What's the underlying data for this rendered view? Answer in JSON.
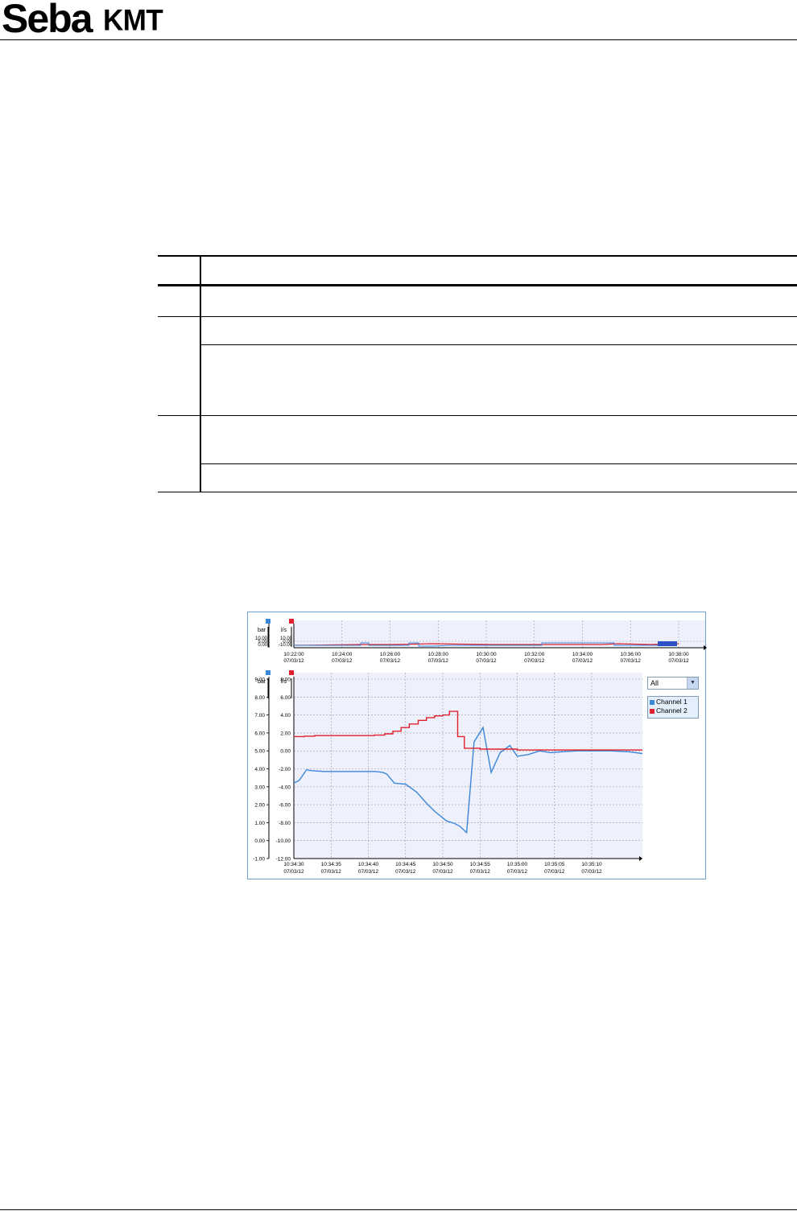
{
  "header": {
    "logo_text_1": "Seba",
    "logo_text_2": "KMT"
  },
  "screenshot": {
    "channel_select": {
      "value": "All"
    },
    "legend": [
      {
        "label": "Channel 1",
        "color": "#3b86d8"
      },
      {
        "label": "Channel 2",
        "color": "#e0202a"
      }
    ],
    "colors": {
      "plot_bg": "#eef0fb",
      "channel1": "#3b86d8",
      "channel2": "#e0202a"
    }
  },
  "chart_data": [
    {
      "type": "line",
      "role": "overview",
      "y_units": {
        "left": "bar",
        "right": "l/s"
      },
      "ticks_left": [
        "10.00",
        "5.00",
        "0.00"
      ],
      "ticks_right": [
        "10.00",
        "0.00",
        "-10.00"
      ],
      "x_ticks": [
        [
          "10:22:00",
          "07/03/12"
        ],
        [
          "10:24:00",
          "07/03/12"
        ],
        [
          "10:26:00",
          "07/03/12"
        ],
        [
          "10:28:00",
          "07/03/12"
        ],
        [
          "10:30:00",
          "07/03/12"
        ],
        [
          "10:32:00",
          "07/03/12"
        ],
        [
          "10:34:00",
          "07/03/12"
        ],
        [
          "10:36:00",
          "07/03/12"
        ],
        [
          "10:38:00",
          "07/03/12"
        ]
      ]
    },
    {
      "type": "line",
      "role": "detail",
      "y_units": {
        "left": "bar",
        "right": "l/s"
      },
      "ylim_left": [
        -1,
        9
      ],
      "ylim_right": [
        -12,
        8
      ],
      "ticks_left": [
        "9.00",
        "8.00",
        "7.00",
        "6.00",
        "5.00",
        "4.00",
        "3.00",
        "2.00",
        "1.00",
        "0.00",
        "-1.00"
      ],
      "ticks_right": [
        "8.00",
        "6.00",
        "4.00",
        "2.00",
        "0.00",
        "-2.00",
        "-4.00",
        "-6.00",
        "-8.00",
        "-10.00",
        "-12.00"
      ],
      "x_ticks": [
        [
          "10:34:30",
          "07/03/12"
        ],
        [
          "10:34:35",
          "07/03/12"
        ],
        [
          "10:34:40",
          "07/03/12"
        ],
        [
          "10:34:45",
          "07/03/12"
        ],
        [
          "10:34:50",
          "07/03/12"
        ],
        [
          "10:34:55",
          "07/03/12"
        ],
        [
          "10:35:00",
          "07/03/12"
        ],
        [
          "10:35:05",
          "07/03/12"
        ],
        [
          "10:35:10",
          "07/03/12"
        ]
      ],
      "series": [
        {
          "name": "Channel 1",
          "axis": "left",
          "x_seconds_after_10_34_30": [
            0,
            0.7,
            1.3,
            1.7,
            2.3,
            4,
            5,
            10,
            11,
            12,
            12.5,
            13.5,
            15,
            16.5,
            18,
            19,
            20.5,
            21.6,
            22.3,
            23.2,
            24.2,
            25.4,
            26.5,
            27.7,
            29,
            30,
            31.5,
            33,
            34.5,
            36,
            38,
            40,
            42.5,
            45,
            47.3
          ],
          "values": [
            3.2,
            3.35,
            3.7,
            3.95,
            3.9,
            3.85,
            3.85,
            3.85,
            3.85,
            3.8,
            3.7,
            3.2,
            3.15,
            2.7,
            2.0,
            1.6,
            1.1,
            0.95,
            0.8,
            0.45,
            5.5,
            6.3,
            3.8,
            4.9,
            5.3,
            4.7,
            4.8,
            5.0,
            4.9,
            4.95,
            5.0,
            5.0,
            5.0,
            4.95,
            4.85
          ]
        },
        {
          "name": "Channel 2",
          "axis": "left",
          "x_seconds_after_10_34_30": [
            0,
            1.4,
            2.8,
            4.2,
            5.5,
            6.8,
            8.2,
            9.5,
            10.8,
            12.2,
            13.3,
            14.4,
            15.5,
            16.7,
            17.8,
            18.9,
            20.0,
            20.9,
            22.0,
            22.9,
            25,
            30,
            35,
            40,
            45,
            47.3
          ],
          "values": [
            5.8,
            5.82,
            5.85,
            5.85,
            5.85,
            5.85,
            5.85,
            5.85,
            5.88,
            5.95,
            6.1,
            6.3,
            6.5,
            6.7,
            6.85,
            6.95,
            7.0,
            7.2,
            5.8,
            5.15,
            5.1,
            5.05,
            5.05,
            5.05,
            5.05,
            5.05
          ]
        }
      ]
    }
  ]
}
